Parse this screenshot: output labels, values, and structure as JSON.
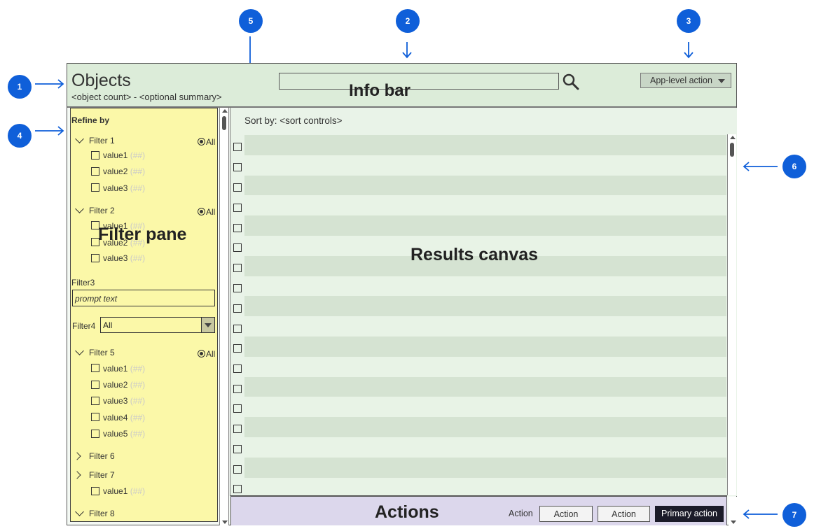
{
  "badges": [
    "1",
    "2",
    "3",
    "4",
    "5",
    "6",
    "7"
  ],
  "header": {
    "title": "Objects",
    "subtitle": "<object count> - <optional summary>",
    "info_bar_label": "Info bar",
    "app_action": "App-level action"
  },
  "filter_pane": {
    "refine_label": "Refine by",
    "pane_label": "Filter pane",
    "all_label": "All",
    "filter1": {
      "label": "Filter 1",
      "values": [
        {
          "name": "value1",
          "count": "(##)"
        },
        {
          "name": "value2",
          "count": "(##)"
        },
        {
          "name": "value3",
          "count": "(##)"
        }
      ]
    },
    "filter2": {
      "label": "Filter 2",
      "values": [
        {
          "name": "value1",
          "count": "(##)"
        },
        {
          "name": "value2",
          "count": "(##)"
        },
        {
          "name": "value3",
          "count": "(##)"
        }
      ]
    },
    "filter3": {
      "label": "Filter3",
      "placeholder": "prompt text"
    },
    "filter4": {
      "label": "Filter4",
      "selected": "All"
    },
    "filter5": {
      "label": "Filter 5",
      "values": [
        {
          "name": "value1",
          "count": "(##)"
        },
        {
          "name": "value2",
          "count": "(##)"
        },
        {
          "name": "value3",
          "count": "(##)"
        },
        {
          "name": "value4",
          "count": "(##)"
        },
        {
          "name": "value5",
          "count": "(##)"
        }
      ]
    },
    "filter6": {
      "label": "Filter 6"
    },
    "filter7": {
      "label": "Filter 7",
      "values": [
        {
          "name": "value1",
          "count": "(##)"
        }
      ]
    },
    "filter8": {
      "label": "Filter 8"
    }
  },
  "results": {
    "sort_label": "Sort by: <sort controls>",
    "canvas_label": "Results canvas"
  },
  "actions": {
    "label": "Actions",
    "action_text": "Action",
    "action_btn_1": "Action",
    "action_btn_2": "Action",
    "primary": "Primary action"
  }
}
